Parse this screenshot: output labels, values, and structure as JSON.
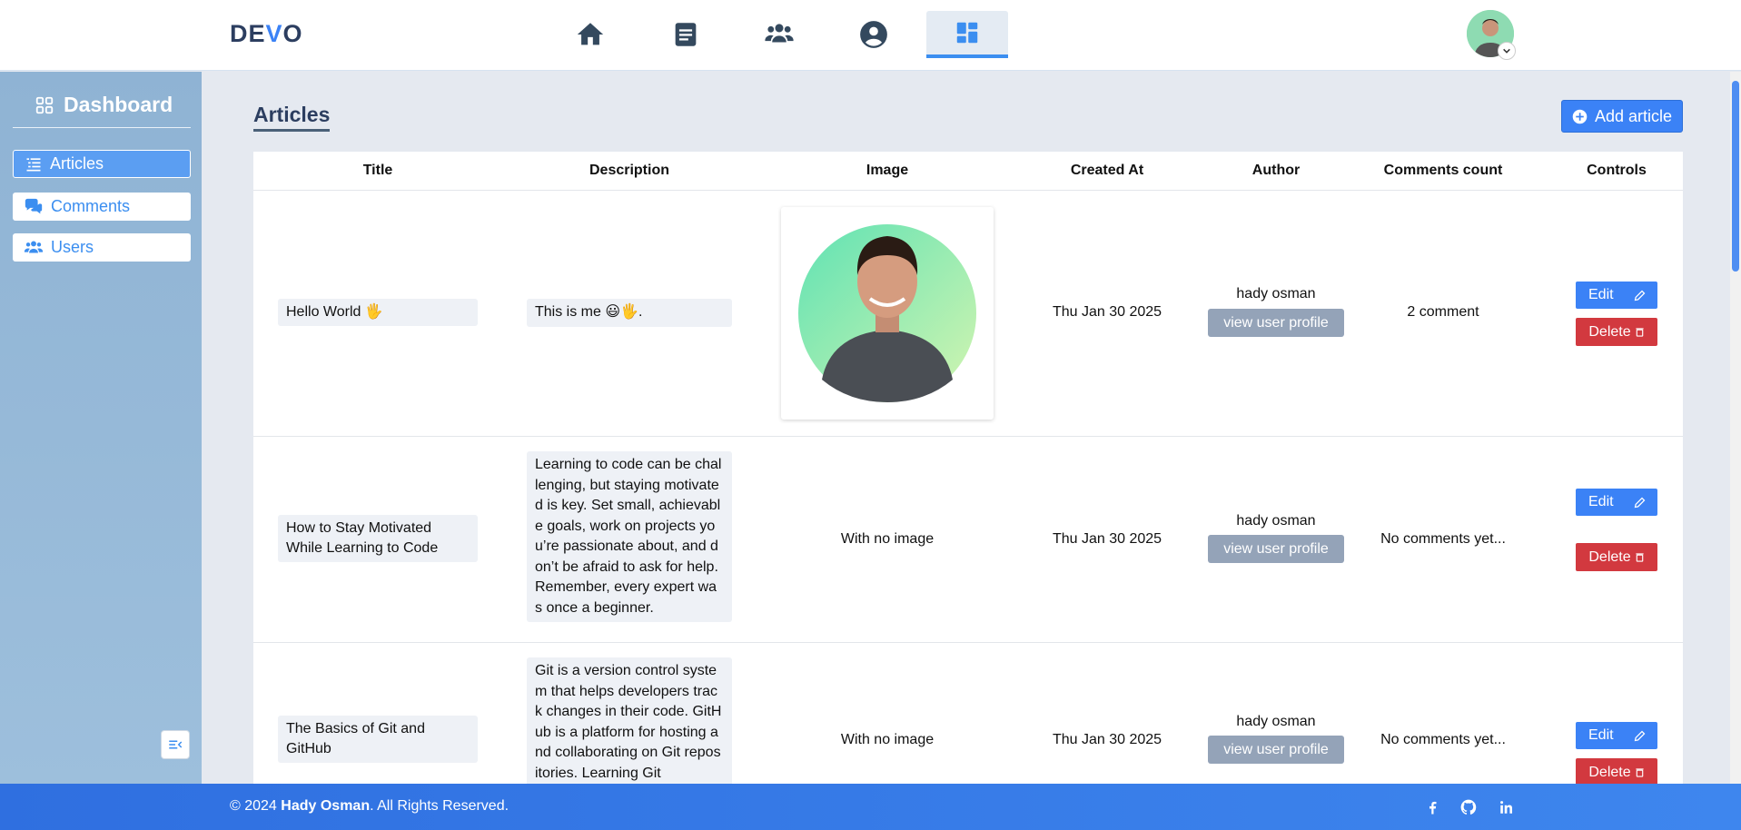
{
  "navbar": {
    "logo_prefix": "DE",
    "logo_accent": "V",
    "logo_suffix": "O",
    "items": [
      {
        "icon": "home-icon"
      },
      {
        "icon": "document-icon"
      },
      {
        "icon": "users-icon"
      },
      {
        "icon": "user-circle-icon"
      },
      {
        "icon": "dashboard-icon",
        "active": true
      }
    ]
  },
  "sidebar": {
    "title": "Dashboard",
    "items": [
      {
        "label": "Articles",
        "icon": "list-icon",
        "active": true
      },
      {
        "label": "Comments",
        "icon": "comments-icon"
      },
      {
        "label": "Users",
        "icon": "users-icon"
      }
    ]
  },
  "main": {
    "title": "Articles",
    "add_button": "Add article"
  },
  "table": {
    "headers": [
      "Title",
      "Description",
      "Image",
      "Created At",
      "Author",
      "Comments count",
      "Controls"
    ],
    "rows": [
      {
        "title": "Hello World 🖐",
        "description": "This is me 😃🖐.",
        "image": "",
        "created_at": "Thu Jan 30 2025",
        "author": "hady osman",
        "profile_button": "view user profile",
        "comments": "2 comment",
        "edit": "Edit",
        "delete": "Delete"
      },
      {
        "title": "How to Stay Motivated While Learning to Code",
        "description": "Learning to code can be challenging, but staying motivated is key. Set small, achievable goals, work on projects you’re passionate about, and don’t be afraid to ask for help. Remember, every expert was once a beginner.",
        "image": "With no image",
        "created_at": "Thu Jan 30 2025",
        "author": "hady osman",
        "profile_button": "view user profile",
        "comments": "No comments yet...",
        "edit": "Edit",
        "delete": "Delete"
      },
      {
        "title": "The Basics of Git and GitHub",
        "description": "Git is a version control system that helps developers track changes in their code. GitHub is a platform for hosting and collaborating on Git repositories. Learning Git",
        "image": "With no image",
        "created_at": "Thu Jan 30 2025",
        "author": "hady osman",
        "profile_button": "view user profile",
        "comments": "No comments yet...",
        "edit": "Edit",
        "delete": "Delete"
      }
    ]
  },
  "footer": {
    "prefix": "© 2024 ",
    "name": "Hady Osman",
    "suffix": ". All Rights Reserved.",
    "social": [
      "facebook-icon",
      "github-icon",
      "linkedin-icon"
    ]
  },
  "colors": {
    "accent": "#3b82f6",
    "danger": "#d2393f",
    "muted_button": "#94a3b8",
    "sidebar": "#9dbfdc",
    "brand_dark": "#2c3e60"
  }
}
